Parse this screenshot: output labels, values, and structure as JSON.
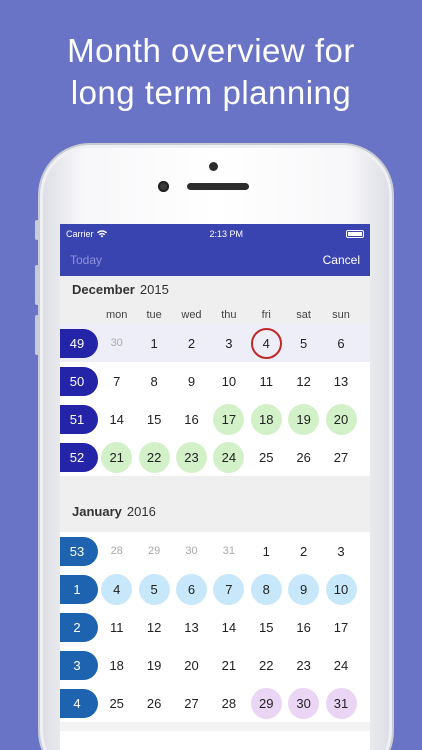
{
  "headline": {
    "line1": "Month overview for",
    "line2": "long term planning"
  },
  "status": {
    "carrier": "Carrier",
    "time": "2:13 PM"
  },
  "nav": {
    "today": "Today",
    "cancel": "Cancel"
  },
  "weekdays": [
    "mon",
    "tue",
    "wed",
    "thu",
    "fri",
    "sat",
    "sun"
  ],
  "months": [
    {
      "name": "December",
      "year": "2015",
      "weeks": [
        {
          "week": "49",
          "days": [
            "30",
            "1",
            "2",
            "3",
            "4",
            "5",
            "6"
          ],
          "styles": [
            "dim",
            "",
            "",
            "",
            "today",
            "",
            ""
          ]
        },
        {
          "week": "50",
          "days": [
            "7",
            "8",
            "9",
            "10",
            "11",
            "12",
            "13"
          ],
          "styles": [
            "",
            "",
            "",
            "",
            "",
            "",
            ""
          ]
        },
        {
          "week": "51",
          "days": [
            "14",
            "15",
            "16",
            "17",
            "18",
            "19",
            "20"
          ],
          "styles": [
            "",
            "",
            "",
            "green",
            "green",
            "green",
            "green"
          ]
        },
        {
          "week": "52",
          "days": [
            "21",
            "22",
            "23",
            "24",
            "25",
            "26",
            "27"
          ],
          "styles": [
            "green",
            "green",
            "green",
            "green",
            "",
            "",
            ""
          ]
        }
      ]
    },
    {
      "name": "January",
      "year": "2016",
      "weeks": [
        {
          "week": "53",
          "days": [
            "28",
            "29",
            "30",
            "31",
            "1",
            "2",
            "3"
          ],
          "styles": [
            "dim",
            "dim",
            "dim",
            "dim",
            "",
            "",
            ""
          ]
        },
        {
          "week": "1",
          "days": [
            "4",
            "5",
            "6",
            "7",
            "8",
            "9",
            "10"
          ],
          "styles": [
            "lblue",
            "lblue",
            "lblue",
            "lblue",
            "lblue",
            "lblue",
            "lblue"
          ]
        },
        {
          "week": "2",
          "days": [
            "11",
            "12",
            "13",
            "14",
            "15",
            "16",
            "17"
          ],
          "styles": [
            "",
            "",
            "",
            "",
            "",
            "",
            ""
          ]
        },
        {
          "week": "3",
          "days": [
            "18",
            "19",
            "20",
            "21",
            "22",
            "23",
            "24"
          ],
          "styles": [
            "",
            "",
            "",
            "",
            "",
            "",
            ""
          ]
        },
        {
          "week": "4",
          "days": [
            "25",
            "26",
            "27",
            "28",
            "29",
            "30",
            "31"
          ],
          "styles": [
            "",
            "",
            "",
            "",
            "pink",
            "pink",
            "pink"
          ]
        }
      ]
    }
  ],
  "colors": {
    "background": "#6a74c6",
    "nav": "#3a44b0",
    "today_ring": "#c02727",
    "green": "#d3f1c8",
    "light_blue": "#c7e7fb",
    "pink": "#ebd5f4"
  }
}
